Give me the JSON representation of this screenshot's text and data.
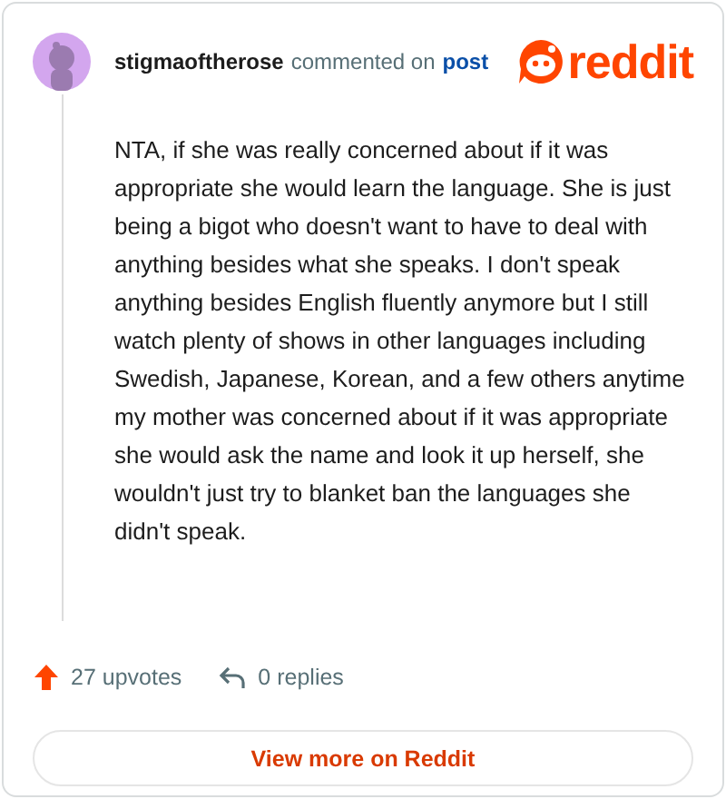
{
  "comment": {
    "author": "stigmaoftherose",
    "action": "commented on",
    "link": "post",
    "logo_text": "reddit",
    "body": "NTA, if she was really concerned about if it was appropriate she would learn the language. She is just being a bigot who doesn't want to have to deal with anything besides what she speaks. I don't speak anything besides English fluently anymore but I still watch plenty of shows in other languages including Swedish, Japanese, Korean, and a few others anytime my mother was concerned about if it was appropriate she would ask the name and look it up herself, she wouldn't just try to blanket ban the languages she didn't speak.",
    "upvotes": "27 upvotes",
    "replies": "0 replies"
  },
  "button": "View more on Reddit"
}
